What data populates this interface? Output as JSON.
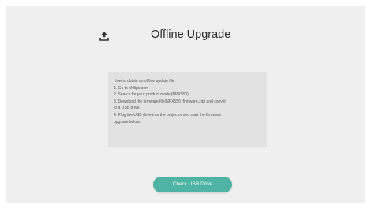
{
  "header": {
    "title": "Offline Upgrade",
    "icon": "upgrade-icon"
  },
  "instructions": {
    "lines": [
      "How to obtain an offline update file:",
      "1. Go to philips.com",
      "2. Search for your product model(NPX550).",
      "3. Download the firmware file(NPX550_firmware.zip) and copy it",
      "to a USB drive.",
      "4. Plug the USB drive into the projector and start the firmware",
      "upgrade below."
    ]
  },
  "button": {
    "label": "Check USB Drive"
  },
  "colors": {
    "accent": "#4fb4a3",
    "background": "#efefef",
    "panel": "#e2e2e2"
  }
}
